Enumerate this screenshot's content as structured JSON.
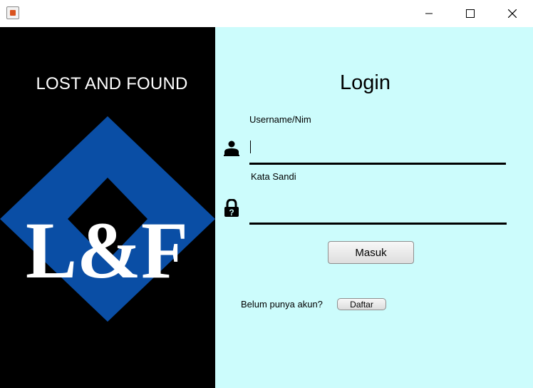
{
  "window": {
    "icon": "java-app-icon",
    "controls": [
      "minimize-icon",
      "maximize-icon",
      "close-icon"
    ]
  },
  "brand": {
    "title": "LOST AND FOUND",
    "logo_text": "L&F",
    "logo_colors": {
      "diamond": "#0a4ea5",
      "background": "#000000",
      "letters": "#ffffff"
    }
  },
  "login": {
    "title": "Login",
    "username_label": "Username/Nim",
    "username_value": "",
    "password_label": "Kata Sandi",
    "password_value": "",
    "submit_label": "Masuk",
    "signup_prompt": "Belum punya akun?",
    "signup_button": "Daftar",
    "panel_color": "#ccfcfc"
  }
}
